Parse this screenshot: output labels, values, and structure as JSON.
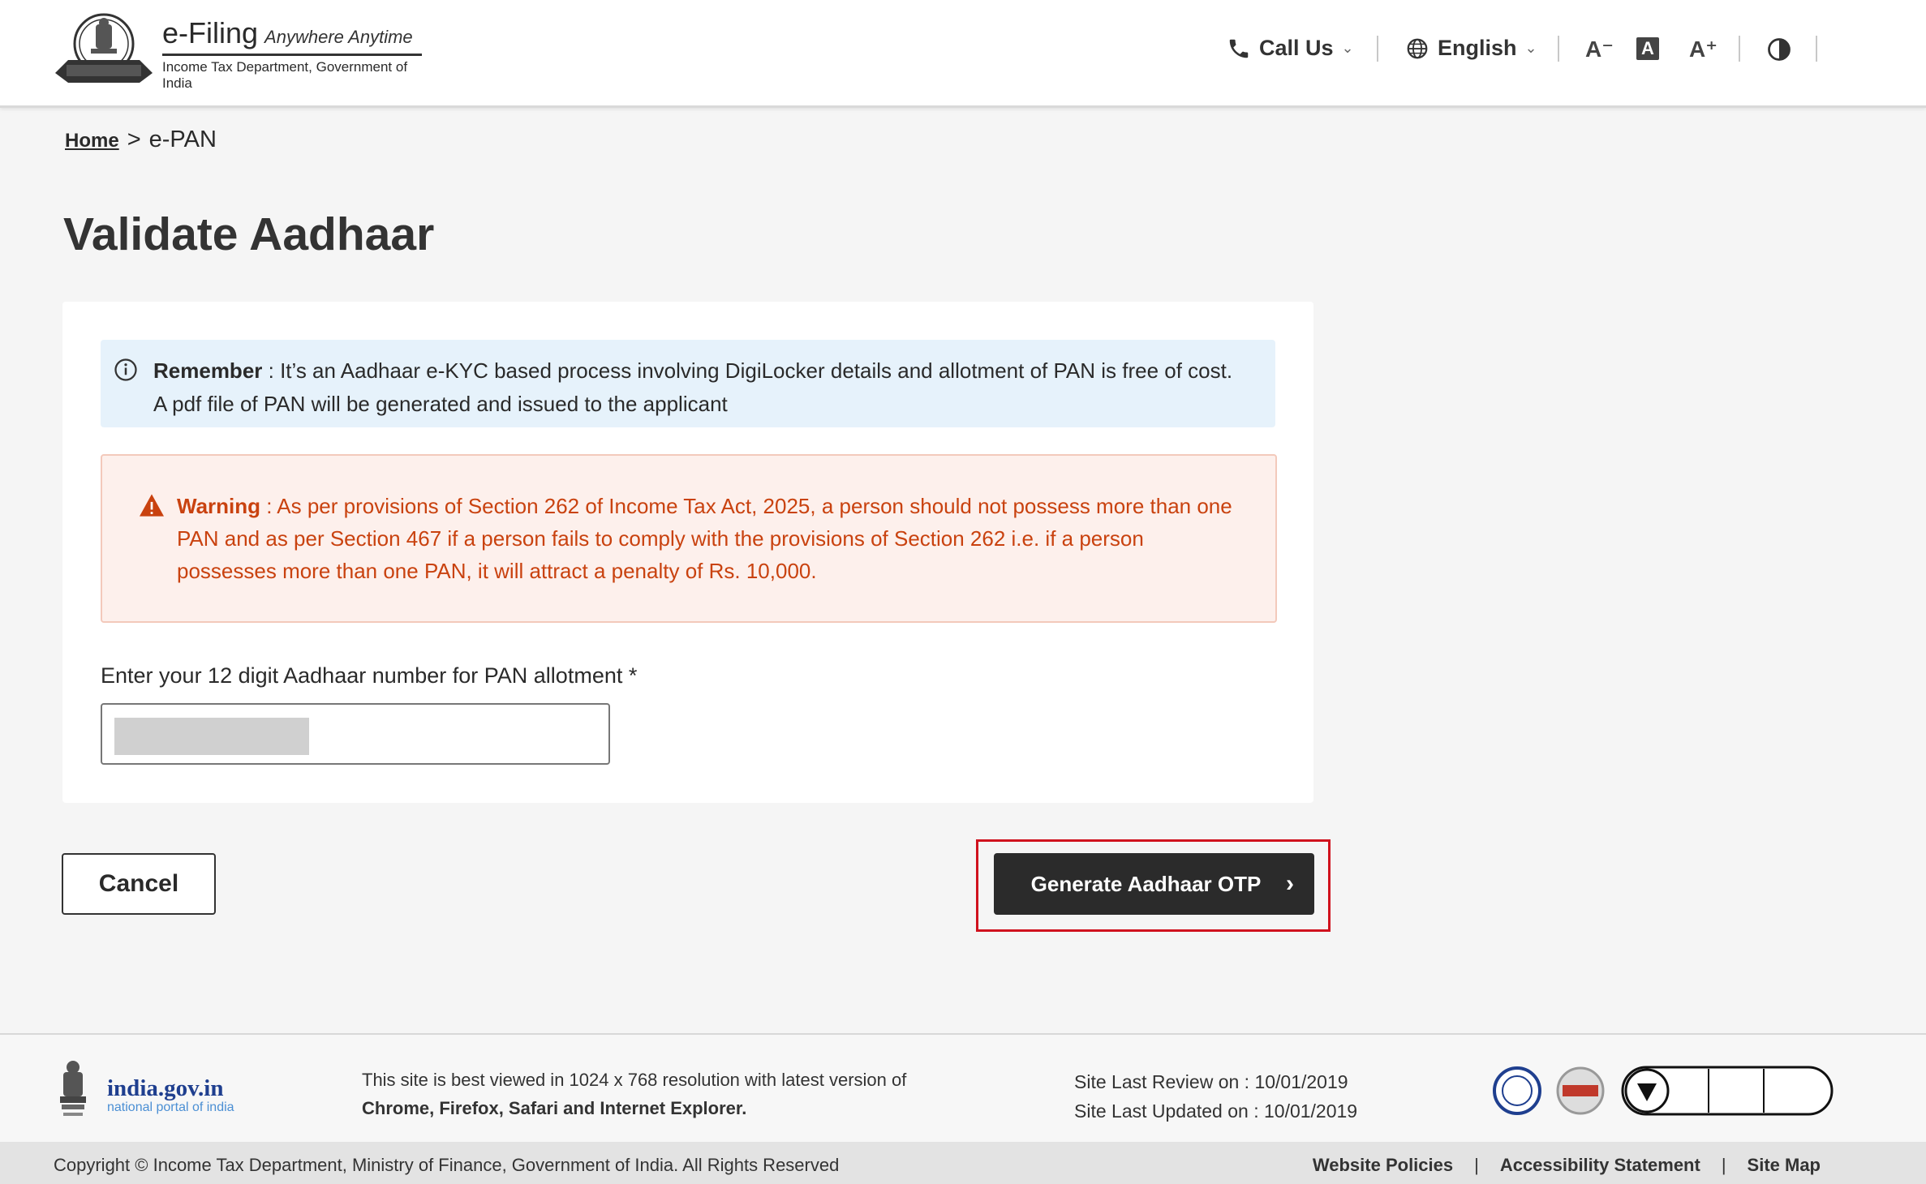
{
  "header": {
    "brand_name": "e-Filing",
    "brand_tag": "Anywhere Anytime",
    "brand_sub": "Income Tax Department, Government of India",
    "call_us": "Call Us",
    "language": "English",
    "font_decrease": "A⁻",
    "font_reset": "A",
    "font_increase": "A⁺"
  },
  "breadcrumb": {
    "home": "Home",
    "separator": ">",
    "current": "e-PAN"
  },
  "page_title": "Validate Aadhaar",
  "info": {
    "label": "Remember",
    "text": " : It’s an Aadhaar e-KYC based process involving DigiLocker details  and allotment of PAN is free of cost.",
    "line2": "A pdf file of PAN will be generated and issued to the applicant"
  },
  "warning": {
    "label": "Warning",
    "text": " :  As per provisions of Section 262 of Income Tax Act, 2025, a person should not possess more than one PAN and as per Section 467 if a person fails to comply with the provisions of Section 262 i.e. if a person possesses more than one PAN, it will attract a penalty of Rs. 10,000."
  },
  "field": {
    "label": "Enter your 12 digit Aadhaar number for PAN allotment *",
    "value": ""
  },
  "buttons": {
    "cancel": "Cancel",
    "generate_otp": "Generate Aadhaar OTP"
  },
  "footer": {
    "india_title": "india.gov.in",
    "india_sub": "national portal of india",
    "best_line1": "This site is best viewed in 1024 x 768 resolution with latest version of",
    "best_line2": "Chrome, Firefox, Safari and Internet Explorer.",
    "review": "Site Last Review on  :  10/01/2019",
    "updated": "Site Last Updated on  : 10/01/2019",
    "copyright": "Copyright © Income Tax Department, Ministry of Finance, Government of India. All Rights Reserved",
    "links": [
      "Website Policies",
      "Accessibility Statement",
      "Site Map"
    ]
  },
  "colors": {
    "accent_dark": "#2b2b2b",
    "info_bg": "#e6f2fb",
    "warning_text": "#c9420f",
    "warning_bg": "#fdf0ec",
    "highlight": "#d0121e"
  }
}
